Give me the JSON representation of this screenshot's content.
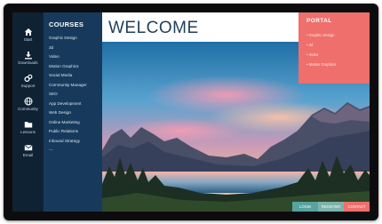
{
  "rail": {
    "items": [
      {
        "label": "Start",
        "icon": "home-icon"
      },
      {
        "label": "Downloads",
        "icon": "download-icon"
      },
      {
        "label": "Support",
        "icon": "support-icon"
      },
      {
        "label": "Community",
        "icon": "globe-icon"
      },
      {
        "label": "Lessons",
        "icon": "folder-icon"
      },
      {
        "label": "Email",
        "icon": "mail-icon"
      }
    ]
  },
  "courses": {
    "title": "COURSES",
    "items": [
      "Graphic Design",
      "3d",
      "Video",
      "Motion Graphics",
      "Social Media",
      "Community Manager",
      "SEO",
      "App Development",
      "Web Design",
      "Online Marketing",
      "Public Relations",
      "Inbound Strategy"
    ],
    "more": "—"
  },
  "main": {
    "title": "WELCOME"
  },
  "portal": {
    "title": "PORTAL",
    "items": [
      "• Graphic Design",
      "• 3d",
      "• Video",
      "• Motion Graphics"
    ]
  },
  "actions": {
    "login": "LOGIN",
    "register": "REGISTER",
    "contact": "CONTACT"
  },
  "colors": {
    "rail": "#0f2234",
    "courses": "#173a5c",
    "title": "#1d3f5e",
    "portal": "#ee6f6c",
    "login": "#58a39f",
    "register": "#7db3ad",
    "contact": "#ee6f6c"
  }
}
